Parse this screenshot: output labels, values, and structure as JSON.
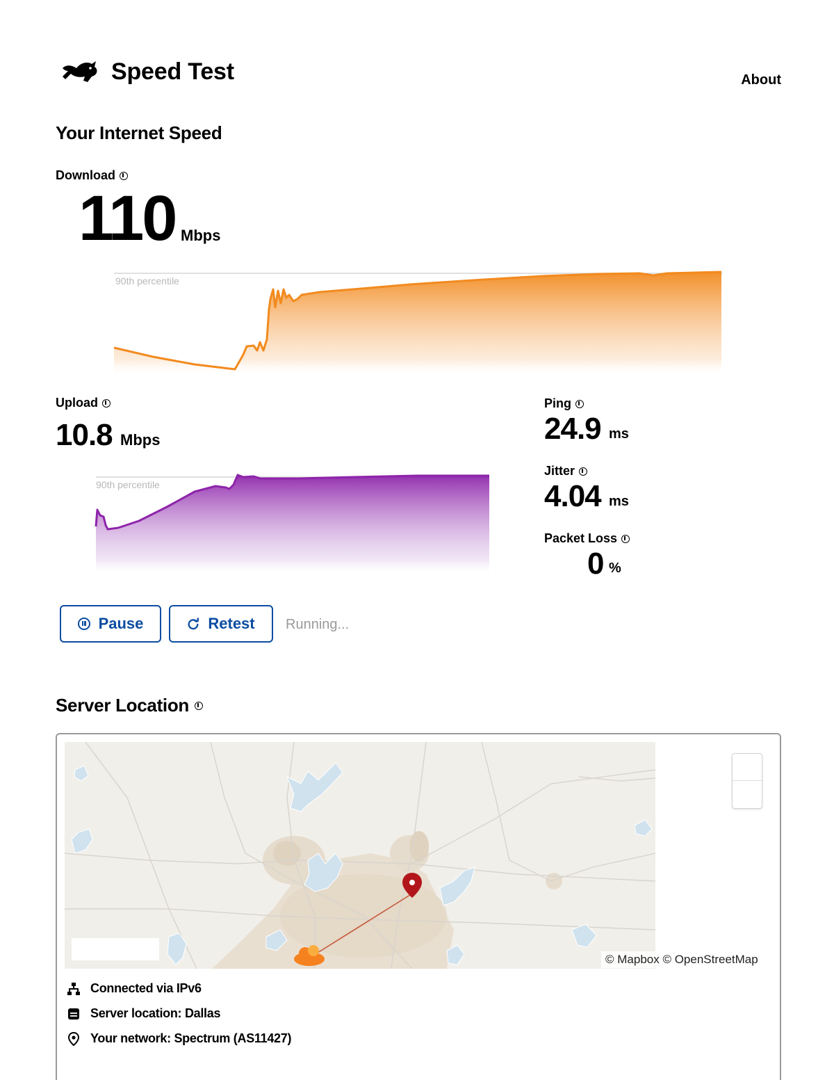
{
  "header": {
    "title": "Speed Test",
    "about_label": "About",
    "logo_icon": "rabbit-logo-icon"
  },
  "speed": {
    "section_title": "Your Internet Speed",
    "download": {
      "label": "Download",
      "value": "110",
      "unit": "Mbps",
      "percentile_label": "90th percentile",
      "color": "#f28a1e"
    },
    "upload": {
      "label": "Upload",
      "value": "10.8",
      "unit": "Mbps",
      "percentile_label": "90th percentile",
      "color": "#8e24aa"
    },
    "ping": {
      "label": "Ping",
      "value": "24.9",
      "unit": "ms"
    },
    "jitter": {
      "label": "Jitter",
      "value": "4.04",
      "unit": "ms"
    },
    "packet_loss": {
      "label": "Packet Loss",
      "value": "0",
      "unit": "%"
    }
  },
  "controls": {
    "pause_label": "Pause",
    "retest_label": "Retest",
    "status": "Running..."
  },
  "server": {
    "section_title": "Server Location",
    "attribution": "© Mapbox © OpenStreetMap",
    "connection": "Connected via IPv6",
    "location": "Server location: Dallas",
    "network": "Your network: Spectrum (AS11427)"
  }
}
